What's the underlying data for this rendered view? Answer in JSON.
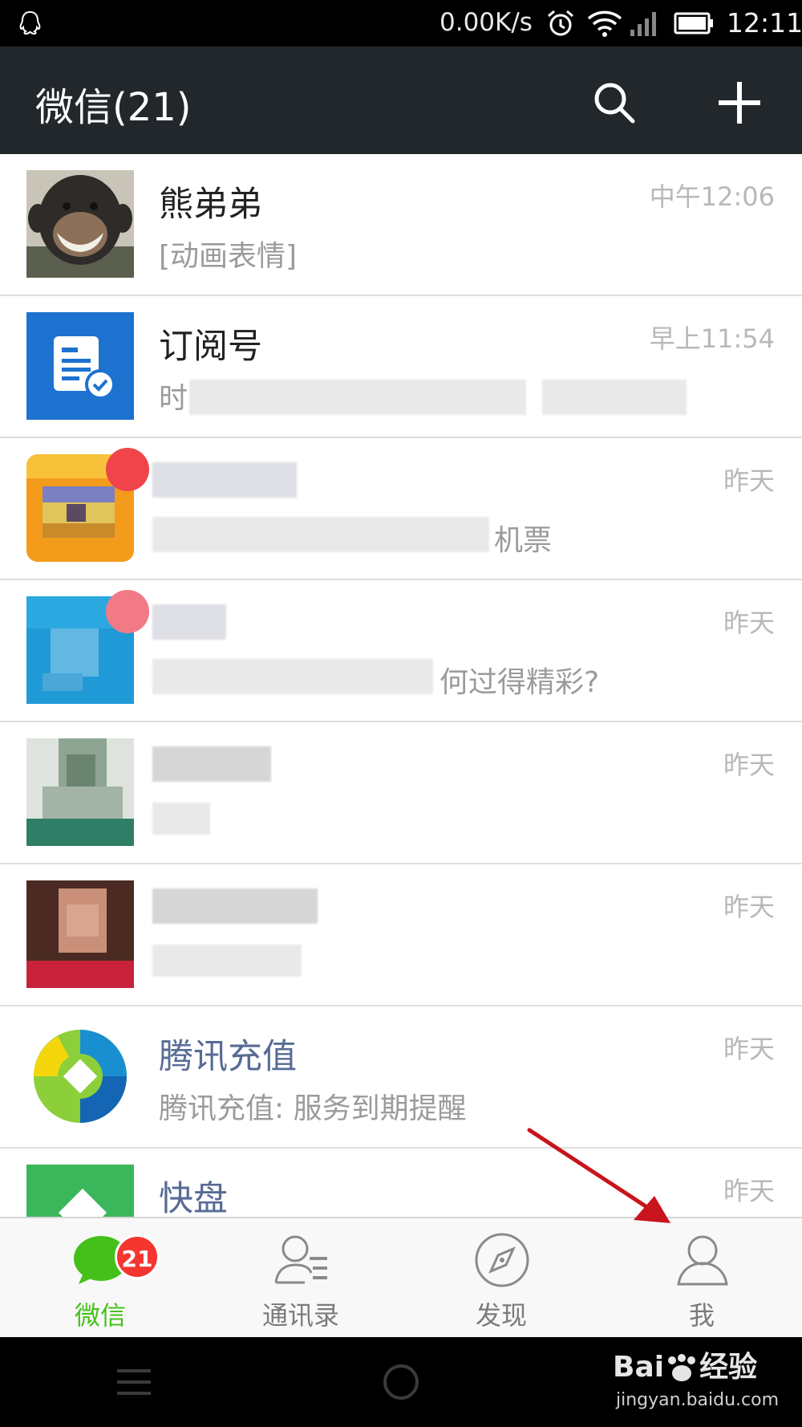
{
  "status_bar": {
    "net_speed": "0.00K/s",
    "time": "12:11",
    "icons": [
      "qq-icon",
      "alarm-icon",
      "wifi-icon",
      "signal-icon",
      "battery-icon"
    ]
  },
  "header": {
    "title": "微信(21)",
    "icons": [
      "search-icon",
      "plus-icon"
    ]
  },
  "chats": [
    {
      "name": "熊弟弟",
      "preview": "[动画表情]",
      "time": "中午12:06"
    },
    {
      "name": "订阅号",
      "preview": "时",
      "time": "早上11:54"
    },
    {
      "name": "",
      "preview": "机票",
      "time": "昨天"
    },
    {
      "name": "",
      "preview": "何过得精彩?",
      "time": "昨天"
    },
    {
      "name": "",
      "preview": "",
      "time": "昨天"
    },
    {
      "name": "",
      "preview": "",
      "time": "昨天"
    },
    {
      "name": "腾讯充值",
      "preview": "腾讯充值: 服务到期提醒",
      "time": "昨天"
    },
    {
      "name": "快盘",
      "preview": "",
      "time": "昨天"
    }
  ],
  "tab_bar": {
    "tabs": [
      {
        "label": "微信",
        "badge": "21",
        "icon": "chat-bubble-icon",
        "active": true
      },
      {
        "label": "通讯录",
        "icon": "contacts-icon"
      },
      {
        "label": "发现",
        "icon": "compass-icon"
      },
      {
        "label": "我",
        "icon": "person-icon"
      }
    ]
  },
  "nav_bar": {
    "icons": [
      "menu-icon",
      "home-icon"
    ]
  },
  "watermark": {
    "main": "Bai",
    "main2": "经验",
    "sub": "jingyan.baidu.com"
  },
  "colors": {
    "header_bg": "#22272c",
    "accent_green": "#45c01a",
    "badge_red": "#f43530",
    "link_blue": "#576b95",
    "annotation_red": "#c8141c"
  }
}
